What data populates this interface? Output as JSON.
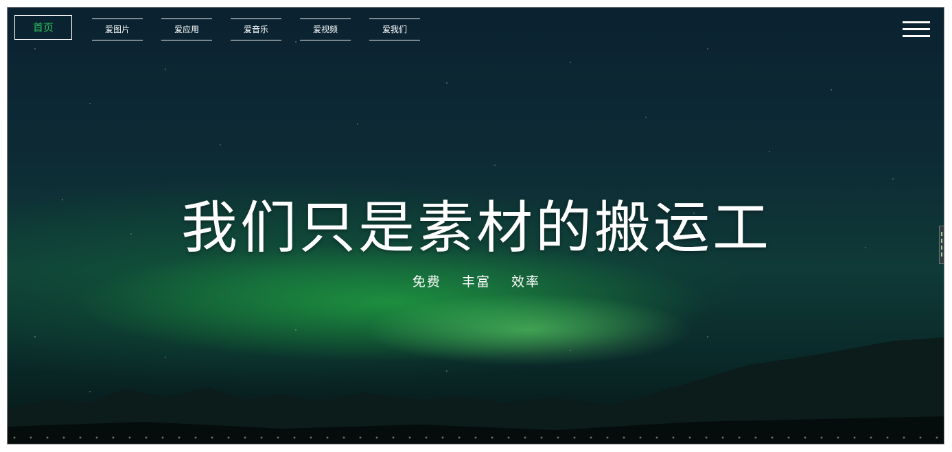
{
  "nav": {
    "home_label": "首页",
    "items": [
      {
        "label": "爱图片"
      },
      {
        "label": "爱应用"
      },
      {
        "label": "爱音乐"
      },
      {
        "label": "爱视频"
      },
      {
        "label": "爱我们"
      }
    ],
    "menu_icon": "hamburger-menu-icon"
  },
  "hero": {
    "title": "我们只是素材的搬运工",
    "subtitle": [
      "免费",
      "丰富",
      "效率"
    ]
  },
  "colors": {
    "accent_green": "#26c35a",
    "text_white": "#ffffff"
  }
}
